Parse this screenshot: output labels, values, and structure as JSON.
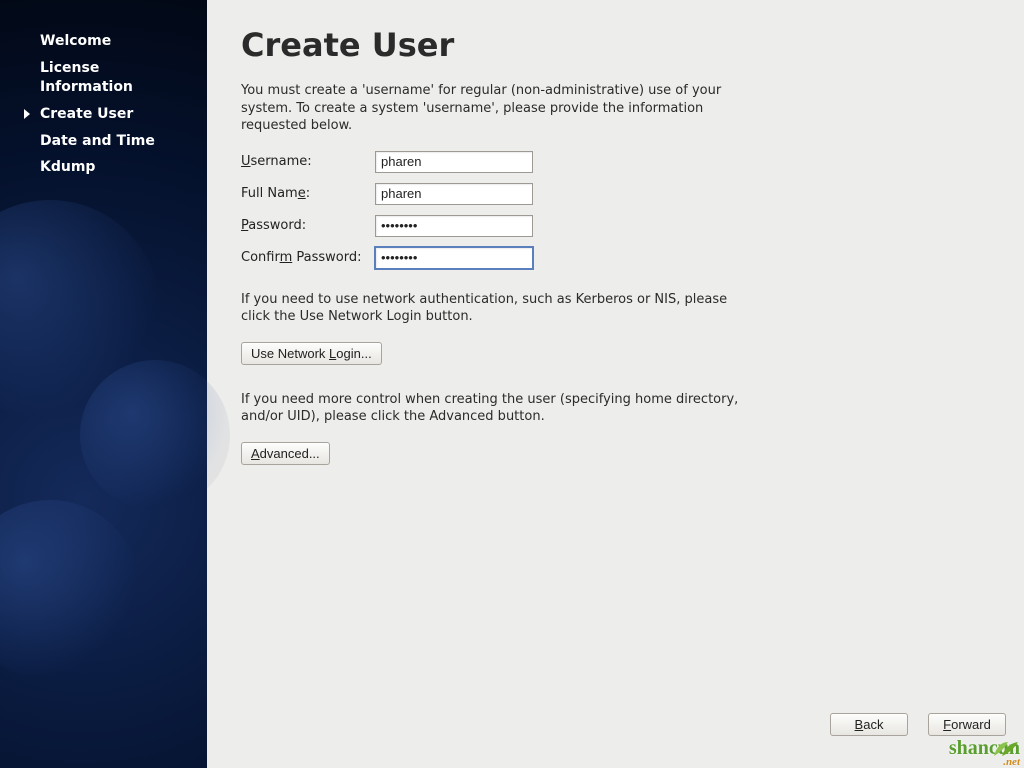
{
  "sidebar": {
    "items": [
      {
        "label": "Welcome",
        "active": false
      },
      {
        "label": "License Information",
        "active": false
      },
      {
        "label": "Create User",
        "active": true
      },
      {
        "label": "Date and Time",
        "active": false
      },
      {
        "label": "Kdump",
        "active": false
      }
    ]
  },
  "page": {
    "title": "Create User",
    "intro": "You must create a 'username' for regular (non-administrative) use of your system.  To create a system 'username', please provide the information requested below.",
    "note_network": "If you need to use network authentication, such as Kerberos or NIS, please click the Use Network Login button.",
    "note_advanced": "If you need more control when creating the user (specifying home directory, and/or UID), please click the Advanced button."
  },
  "form": {
    "username_label_pre": "U",
    "username_label_post": "sername:",
    "username_value": "pharen",
    "fullname_label_pre": "Full Nam",
    "fullname_label_mid": "e",
    "fullname_label_post": ":",
    "fullname_value": "pharen",
    "password_label_pre": "P",
    "password_label_post": "assword:",
    "password_value": "••••••••",
    "confirm_label_pre": "Confir",
    "confirm_label_mid": "m",
    "confirm_label_post": " Password:",
    "confirm_value": "••••••••"
  },
  "buttons": {
    "network_login_pre": "Use Network ",
    "network_login_ul": "L",
    "network_login_post": "ogin...",
    "advanced_ul": "A",
    "advanced_post": "dvanced...",
    "back_ul": "B",
    "back_post": "ack",
    "forward_ul": "F",
    "forward_post": "orward"
  },
  "watermark": {
    "text": "shancun",
    "sub": ".net"
  }
}
